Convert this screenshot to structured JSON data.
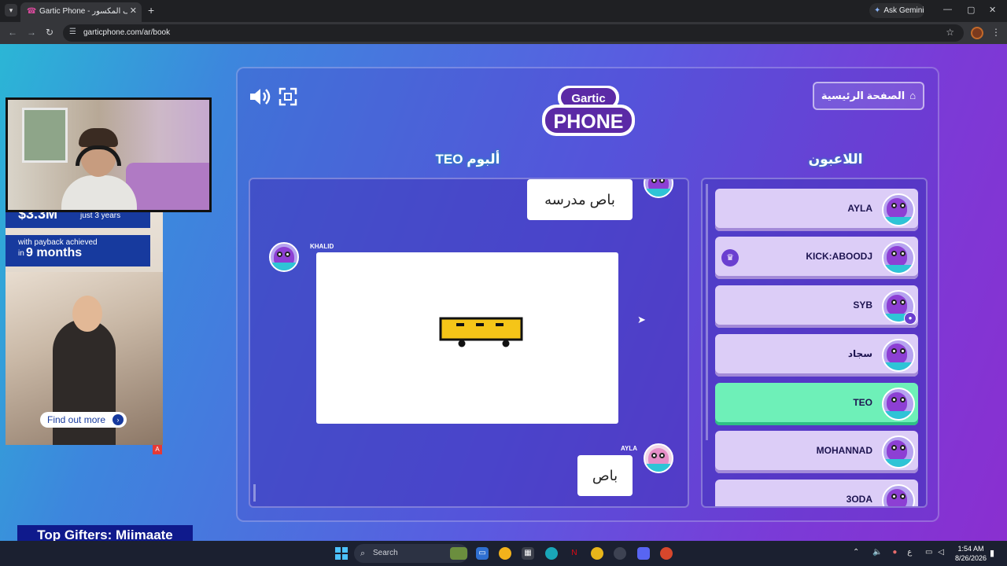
{
  "browser": {
    "tab_title": "Gartic Phone - الهاتف المكسور",
    "new_tab": "+",
    "ask_gemini": "Ask Gemini",
    "url": "garticphone.com/ar/book",
    "win_min": "—",
    "win_max": "▢",
    "win_close": "✕"
  },
  "ad": {
    "amount": "$3.3M",
    "years": "just 3 years",
    "payback_line1": "with payback achieved",
    "payback_in": "in",
    "payback_months": "9 months",
    "cta": "Find out more",
    "badge": "A"
  },
  "overlay": {
    "gifters": "Top Gifters: Miimaate"
  },
  "game": {
    "logo_top": "Gartic",
    "logo_bottom": "PHONE",
    "home_button": "الصفحة الرئيسية",
    "album_title": "ألبوم TEO",
    "players_title": "اللاعبون",
    "album": {
      "top_guess": "باص مدرسه",
      "drawing_author": "KHALID",
      "bottom_author": "AYLA",
      "bottom_guess": "باص"
    },
    "players": [
      {
        "name": "AYLA",
        "host": false,
        "active": false
      },
      {
        "name": "KICK:ABOODJ",
        "host": true,
        "active": false
      },
      {
        "name": "SYB",
        "host": false,
        "active": false,
        "badge": true
      },
      {
        "name": "سجاد",
        "host": false,
        "active": false
      },
      {
        "name": "TEO",
        "host": false,
        "active": true
      },
      {
        "name": "MOHANNAD",
        "host": false,
        "active": false
      },
      {
        "name": "3ODA",
        "host": false,
        "active": false
      }
    ]
  },
  "taskbar": {
    "search": "Search",
    "lang": "ع",
    "time": "1:54 AM",
    "date": "8/26/2026"
  },
  "colors": {
    "active_player": "#6ef0b8",
    "player_card": "#dccdf7",
    "bus_yellow": "#f5c518"
  }
}
